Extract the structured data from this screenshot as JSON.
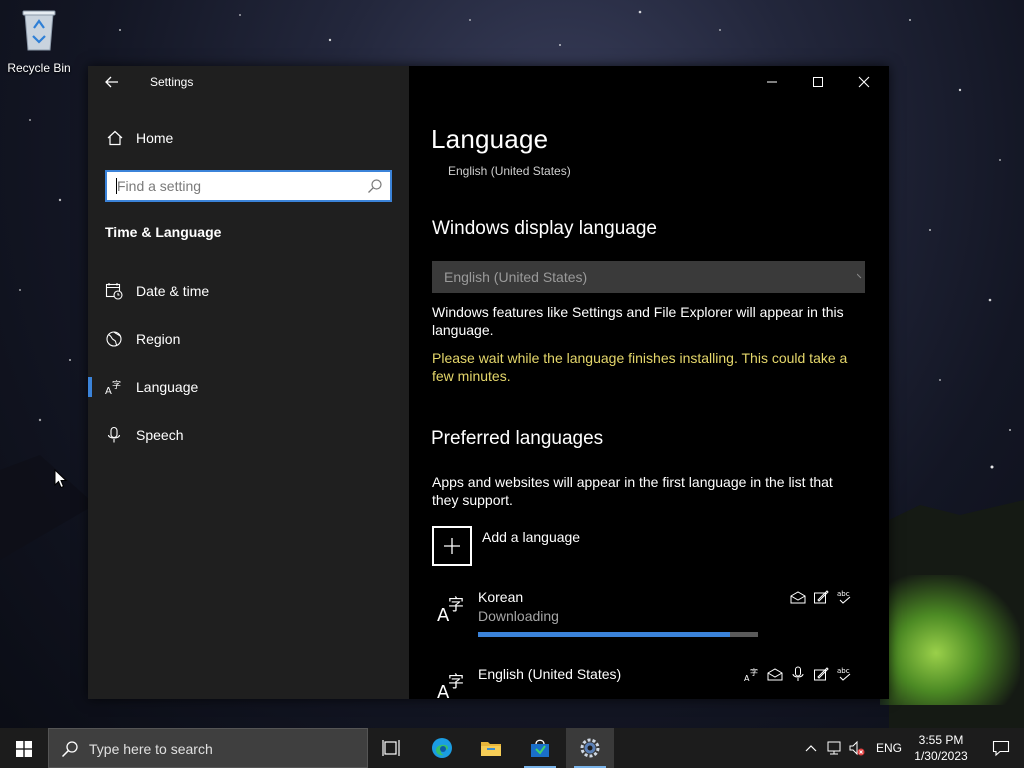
{
  "desktop": {
    "recycle_bin_label": "Recycle Bin"
  },
  "window": {
    "app_title": "Settings",
    "sidebar": {
      "home_label": "Home",
      "search_placeholder": "Find a setting",
      "section_title": "Time & Language",
      "items": [
        {
          "label": "Date & time",
          "icon": "calendar-clock-icon",
          "selected": false
        },
        {
          "label": "Region",
          "icon": "globe-icon",
          "selected": false
        },
        {
          "label": "Language",
          "icon": "language-icon",
          "selected": true
        },
        {
          "label": "Speech",
          "icon": "microphone-icon",
          "selected": false
        }
      ]
    },
    "main": {
      "title": "Language",
      "subtitle": "English (United States)",
      "display_language": {
        "heading": "Windows display language",
        "selected_value": "English (United States)",
        "description": "Windows features like Settings and File Explorer will appear in this language.",
        "warning": "Please wait while the language finishes installing. This could take a few minutes."
      },
      "preferred": {
        "heading": "Preferred languages",
        "description": "Apps and websites will appear in the first language in the list that they support.",
        "add_label": "Add a language",
        "languages": [
          {
            "name": "Korean",
            "status": "Downloading",
            "progress": 0.9,
            "features": [
              "display-language-icon",
              "handwriting-icon",
              "spellcheck-icon"
            ]
          },
          {
            "name": "English (United States)",
            "features": [
              "language-pack-icon",
              "text-to-speech-icon",
              "speech-icon",
              "handwriting-icon",
              "spellcheck-icon"
            ]
          }
        ]
      }
    }
  },
  "taskbar": {
    "search_placeholder": "Type here to search",
    "apps": [
      "task-view-icon",
      "edge-icon",
      "file-explorer-icon",
      "store-icon",
      "settings-icon"
    ],
    "language": "ENG",
    "time": "3:55 PM",
    "date": "1/30/2023"
  },
  "colors": {
    "accent": "#3b83d9",
    "warning": "#e5d76b",
    "sidebar_bg": "#1f1f1f",
    "main_bg": "#000000",
    "taskbar_bg": "#1c1c1c"
  }
}
